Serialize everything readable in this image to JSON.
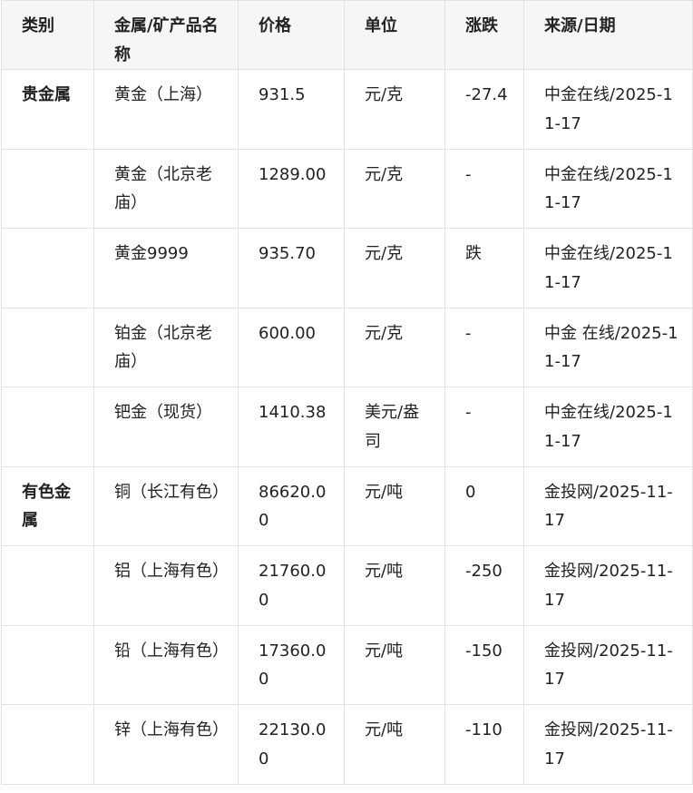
{
  "table": {
    "headers": [
      "类别",
      "金属/矿产品名称",
      "价格",
      "单位",
      "涨跌",
      "来源/日期"
    ],
    "rows": [
      {
        "category": "贵金属",
        "name": "黄金（上海）",
        "price": "931.5",
        "unit": "元/克",
        "change": "-27.4",
        "source": "中金在线/2025-11-17"
      },
      {
        "category": "",
        "name": "黄金（北京老庙）",
        "price": "1289.00",
        "unit": "元/克",
        "change": "-",
        "source": "中金在线/2025-11-17"
      },
      {
        "category": "",
        "name": "黄金9999",
        "price": "935.70",
        "unit": "元/克",
        "change": "跌",
        "source": "中金在线/2025-11-17"
      },
      {
        "category": "",
        "name": "铂金（北京老庙）",
        "price": "600.00",
        "unit": "元/克",
        "change": "-",
        "source": "中金 在线/2025-11-17"
      },
      {
        "category": "",
        "name": "钯金（现货）",
        "price": "1410.38",
        "unit": "美元/盎司",
        "change": "-",
        "source": "中金在线/2025-11-17"
      },
      {
        "category": "有色金属",
        "name": "铜（长江有色）",
        "price": "86620.00",
        "unit": "元/吨",
        "change": "0",
        "source": "金投网/2025-11-17"
      },
      {
        "category": "",
        "name": "铝（上海有色）",
        "price": "21760.00",
        "unit": "元/吨",
        "change": "-250",
        "source": "金投网/2025-11-17"
      },
      {
        "category": "",
        "name": "铅（上海有色）",
        "price": "17360.00",
        "unit": "元/吨",
        "change": "-150",
        "source": "金投网/2025-11-17"
      },
      {
        "category": "",
        "name": "锌（上海有色）",
        "price": "22130.00",
        "unit": "元/吨",
        "change": "-110",
        "source": "金投网/2025-11-17"
      }
    ]
  }
}
